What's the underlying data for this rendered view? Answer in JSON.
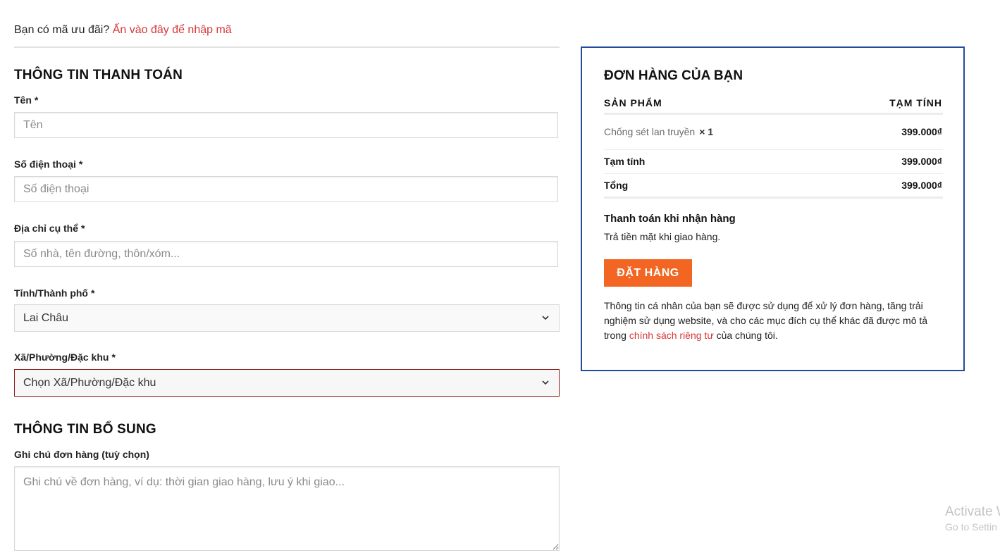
{
  "coupon": {
    "prompt": "Bạn có mã ưu đãi?",
    "link": "Ấn vào đây để nhập mã"
  },
  "billing": {
    "title": "THÔNG TIN THANH TOÁN",
    "name": {
      "label": "Tên",
      "required": "*",
      "placeholder": "Tên"
    },
    "phone": {
      "label": "Số điện thoại",
      "required": "*",
      "placeholder": "Số điện thoại"
    },
    "address": {
      "label": "Địa chỉ cụ thể",
      "required": "*",
      "placeholder": "Số nhà, tên đường, thôn/xóm..."
    },
    "province": {
      "label": "Tỉnh/Thành phố",
      "required": "*",
      "value": "Lai Châu"
    },
    "ward": {
      "label": "Xã/Phường/Đặc khu",
      "required": "*",
      "value": "Chọn Xã/Phường/Đặc khu"
    }
  },
  "additional": {
    "title": "THÔNG TIN BỔ SUNG",
    "notes": {
      "label": "Ghi chú đơn hàng (tuỳ chọn)",
      "placeholder": "Ghi chú về đơn hàng, ví dụ: thời gian giao hàng, lưu ý khi giao..."
    }
  },
  "order": {
    "title": "ĐƠN HÀNG CỦA BẠN",
    "col_product": "SẢN PHẨM",
    "col_subtotal": "TẠM TÍNH",
    "item": {
      "name": "Chống sét lan truyền",
      "qty": "× 1",
      "price": "399.000₫"
    },
    "subtotal": {
      "label": "Tạm tính",
      "value": "399.000₫"
    },
    "total": {
      "label": "Tổng",
      "value": "399.000₫"
    },
    "payment": {
      "title": "Thanh toán khi nhận hàng",
      "desc": "Trả tiền mặt khi giao hàng."
    },
    "place_order": "ĐẶT HÀNG",
    "privacy": {
      "before": "Thông tin cá nhân của bạn sẽ được sử dụng để xử lý đơn hàng, tăng trải nghiệm sử dụng website, và cho các mục đích cụ thể khác đã được mô tả trong ",
      "link": "chính sách riêng tư",
      "after": " của chúng tôi."
    }
  },
  "watermark": {
    "line1": "Activate W",
    "line2": "Go to Settin"
  },
  "colors": {
    "accent": "#d63638",
    "button": "#f26522",
    "box_border": "#1f4e99",
    "invalid_border": "#8b1a1a"
  },
  "icons": {
    "select_arrow": "chevron-down-icon"
  }
}
